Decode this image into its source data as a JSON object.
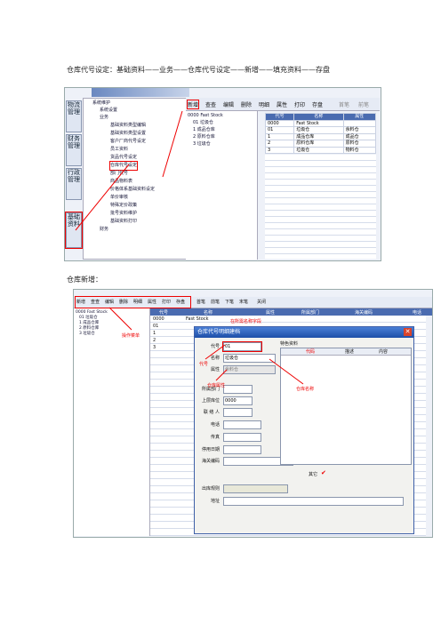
{
  "captions": {
    "line1": "仓库代号设定：基础资料——业务——仓库代号设定——新增——填充资料——存盘",
    "line2": "仓库新增："
  },
  "screen1": {
    "side_tabs": [
      "物流管理",
      "财务管理",
      "行政管理",
      "基础资料"
    ],
    "tree": [
      "系统维护",
      "系统设置",
      "业务",
      "基础资料类型编辑",
      "基础资料类型设置",
      "客户厂商代号设定",
      "员工资料",
      "货品代号设定",
      "仓库代号设定",
      "部门代号",
      "商品物料表",
      "价格体系基础资料设定",
      "单价审核",
      "特殊定价政策",
      "批号资料维护",
      "基础资料打印",
      "财务"
    ],
    "toolbar": [
      "新增",
      "查查",
      "编辑",
      "删除",
      "明细",
      "属性",
      "打印",
      "存盘",
      "首笔",
      "前笔"
    ],
    "tree2": [
      "0000 Fast Stock",
      "01 垃圾仓",
      "1 成品仓库",
      "2 原料仓库",
      "3 垃圾仓"
    ],
    "table_headers": [
      "代号",
      "名称",
      "属性"
    ],
    "rows": [
      [
        "0000",
        "Fast Stock",
        ""
      ],
      [
        "01",
        "垃圾仓",
        "余料仓"
      ],
      [
        "1",
        "成品仓库",
        "成品仓"
      ],
      [
        "2",
        "原料仓库",
        "原料仓"
      ],
      [
        "3",
        "垃圾仓",
        "物料仓"
      ]
    ]
  },
  "screen2": {
    "toolbar": [
      "新增",
      "查查",
      "编辑",
      "删除",
      "明细",
      "属性",
      "打印",
      "存盘",
      "首笔",
      "前笔",
      "下笔",
      "末笔",
      "关闭"
    ],
    "tree": [
      "0000 Fast Stock",
      "01 垃圾仓",
      "1 成品仓库",
      "2 原料仓库",
      "3 垃圾仓"
    ],
    "table_headers": [
      "代号",
      "名称",
      "属性",
      "所属部门",
      "海关编码",
      "电话"
    ],
    "rows": [
      "0000",
      "01",
      "1",
      "2",
      "3"
    ],
    "row_name0": "Fast Stock",
    "dialog": {
      "title": "仓库代号明细建档",
      "labels": {
        "code": "代号",
        "name": "名称",
        "attr": "属性",
        "dept": "所属部门",
        "upper": "上层库位",
        "contact": "联 络 人",
        "phone": "电话",
        "fax": "传真",
        "stop": "停用日期",
        "customs": "海关编码",
        "other": "其它",
        "out_rule": "出库规则",
        "addr": "地址"
      },
      "values": {
        "code": "01",
        "name": "垃圾仓",
        "attr": "余料仓",
        "upper": "0000"
      },
      "special_title": "特色资料",
      "special_headers": [
        "代码",
        "描述",
        "内容"
      ]
    },
    "annotations": {
      "toolbar_note": "操作菜单",
      "name_note": "在所需名称字段",
      "code_note": "代号",
      "attr_note": "仓库属性",
      "wh_name_note": "仓库名称"
    }
  }
}
